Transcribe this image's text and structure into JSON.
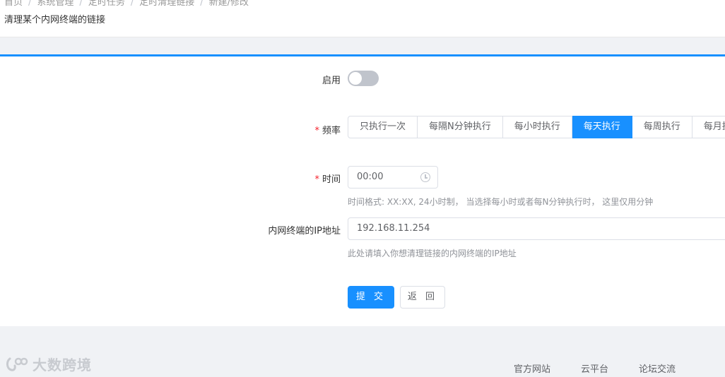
{
  "breadcrumb": [
    "首页",
    "系统管理",
    "定时任务",
    "定时清理链接",
    "新建/修改"
  ],
  "page": {
    "subtitle": "清理某个内网终端的链接"
  },
  "form": {
    "enable": {
      "label": "启用",
      "on": false
    },
    "frequency": {
      "label": "频率",
      "required_mark": "*",
      "options": [
        "只执行一次",
        "每隔N分钟执行",
        "每小时执行",
        "每天执行",
        "每周执行",
        "每月执行"
      ],
      "selected": "每天执行"
    },
    "time": {
      "label": "时间",
      "required_mark": "*",
      "value": "00:00",
      "hint": "时间格式: XX:XX, 24小时制， 当选择每小时或者每N分钟执行时， 这里仅用分钟"
    },
    "ip": {
      "label": "内网终端的IP地址",
      "value": "192.168.11.254",
      "hint": "此处请填入你想清理链接的内网终端的IP地址"
    },
    "submit_label": "提 交",
    "back_label": "返 回"
  },
  "footer": {
    "links": [
      "官方网站",
      "云平台",
      "论坛交流"
    ],
    "watermark": "大数跨境"
  },
  "colors": {
    "primary": "#1890ff",
    "required": "#f5222d",
    "background": "#f0f2f5"
  }
}
